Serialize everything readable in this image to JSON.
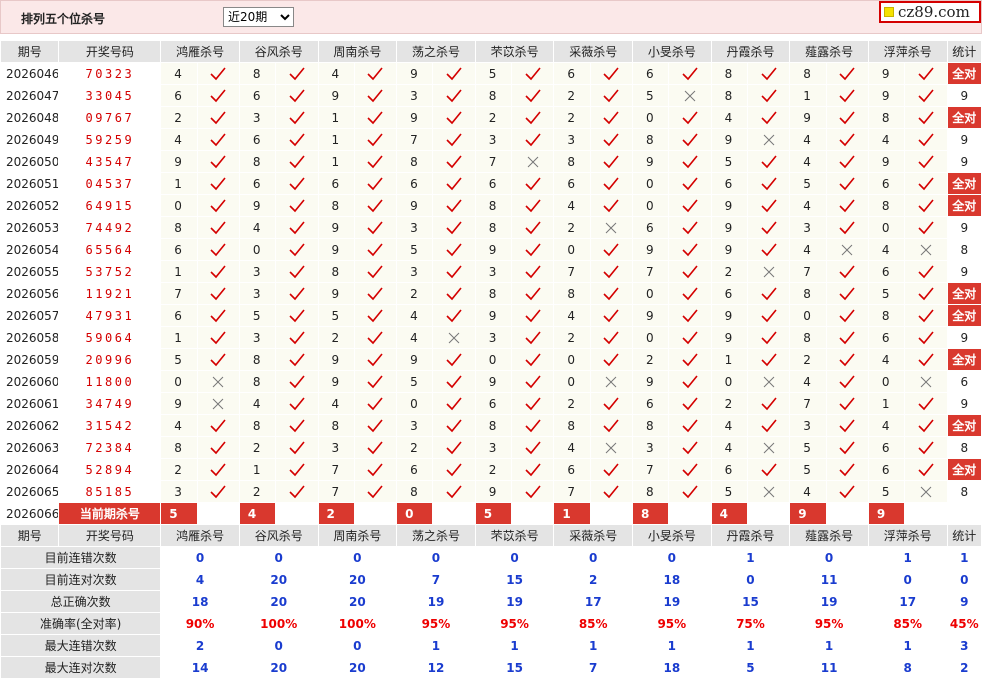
{
  "header": {
    "title": "排列五个位杀号",
    "period_selected": "近20期",
    "logo_text": "cz89.com"
  },
  "columns": {
    "issue": "期号",
    "number": "开奖号码",
    "stat": "统计",
    "killers": [
      "鸿雁杀号",
      "谷风杀号",
      "周南杀号",
      "荡之杀号",
      "芣苡杀号",
      "采薇杀号",
      "小旻杀号",
      "丹霞杀号",
      "薤露杀号",
      "浮萍杀号"
    ]
  },
  "marks": {
    "all_right": "全对"
  },
  "rows": [
    {
      "issue": "2026046",
      "number": "70323",
      "kills": [
        4,
        8,
        4,
        9,
        5,
        6,
        6,
        8,
        8,
        9
      ],
      "hits": [
        1,
        1,
        1,
        1,
        1,
        1,
        1,
        1,
        1,
        1
      ],
      "stat": "全对"
    },
    {
      "issue": "2026047",
      "number": "33045",
      "kills": [
        6,
        6,
        9,
        3,
        8,
        2,
        5,
        8,
        1,
        9
      ],
      "hits": [
        1,
        1,
        1,
        1,
        1,
        1,
        0,
        1,
        1,
        1
      ],
      "stat": "9"
    },
    {
      "issue": "2026048",
      "number": "09767",
      "kills": [
        2,
        3,
        1,
        9,
        2,
        2,
        0,
        4,
        9,
        8
      ],
      "hits": [
        1,
        1,
        1,
        1,
        1,
        1,
        1,
        1,
        1,
        1
      ],
      "stat": "全对"
    },
    {
      "issue": "2026049",
      "number": "59259",
      "kills": [
        4,
        6,
        1,
        7,
        3,
        3,
        8,
        9,
        4,
        4
      ],
      "hits": [
        1,
        1,
        1,
        1,
        1,
        1,
        1,
        0,
        1,
        1
      ],
      "stat": "9"
    },
    {
      "issue": "2026050",
      "number": "43547",
      "kills": [
        9,
        8,
        1,
        8,
        7,
        8,
        9,
        5,
        4,
        9
      ],
      "hits": [
        1,
        1,
        1,
        1,
        0,
        1,
        1,
        1,
        1,
        1
      ],
      "stat": "9"
    },
    {
      "issue": "2026051",
      "number": "04537",
      "kills": [
        1,
        6,
        6,
        6,
        6,
        6,
        0,
        6,
        5,
        6
      ],
      "hits": [
        1,
        1,
        1,
        1,
        1,
        1,
        1,
        1,
        1,
        1
      ],
      "stat": "全对"
    },
    {
      "issue": "2026052",
      "number": "64915",
      "kills": [
        0,
        9,
        8,
        9,
        8,
        4,
        0,
        9,
        4,
        8
      ],
      "hits": [
        1,
        1,
        1,
        1,
        1,
        1,
        1,
        1,
        1,
        1
      ],
      "stat": "全对"
    },
    {
      "issue": "2026053",
      "number": "74492",
      "kills": [
        8,
        4,
        9,
        3,
        8,
        2,
        6,
        9,
        3,
        0
      ],
      "hits": [
        1,
        1,
        1,
        1,
        1,
        0,
        1,
        1,
        1,
        1
      ],
      "stat": "9"
    },
    {
      "issue": "2026054",
      "number": "65564",
      "kills": [
        6,
        0,
        9,
        5,
        9,
        0,
        9,
        9,
        4,
        4
      ],
      "hits": [
        1,
        1,
        1,
        1,
        1,
        1,
        1,
        1,
        0,
        0
      ],
      "stat": "8"
    },
    {
      "issue": "2026055",
      "number": "53752",
      "kills": [
        1,
        3,
        8,
        3,
        3,
        7,
        7,
        2,
        7,
        6
      ],
      "hits": [
        1,
        1,
        1,
        1,
        1,
        1,
        1,
        0,
        1,
        1
      ],
      "stat": "9"
    },
    {
      "issue": "2026056",
      "number": "11921",
      "kills": [
        7,
        3,
        9,
        2,
        8,
        8,
        0,
        6,
        8,
        5
      ],
      "hits": [
        1,
        1,
        1,
        1,
        1,
        1,
        1,
        1,
        1,
        1
      ],
      "stat": "全对"
    },
    {
      "issue": "2026057",
      "number": "47931",
      "kills": [
        6,
        5,
        5,
        4,
        9,
        4,
        9,
        9,
        0,
        8
      ],
      "hits": [
        1,
        1,
        1,
        1,
        1,
        1,
        1,
        1,
        1,
        1
      ],
      "stat": "全对"
    },
    {
      "issue": "2026058",
      "number": "59064",
      "kills": [
        1,
        3,
        2,
        4,
        3,
        2,
        0,
        9,
        8,
        6
      ],
      "hits": [
        1,
        1,
        1,
        0,
        1,
        1,
        1,
        1,
        1,
        1
      ],
      "stat": "9"
    },
    {
      "issue": "2026059",
      "number": "20996",
      "kills": [
        5,
        8,
        9,
        9,
        0,
        0,
        2,
        1,
        2,
        4
      ],
      "hits": [
        1,
        1,
        1,
        1,
        1,
        1,
        1,
        1,
        1,
        1
      ],
      "stat": "全对"
    },
    {
      "issue": "2026060",
      "number": "11800",
      "kills": [
        0,
        8,
        9,
        5,
        9,
        0,
        9,
        0,
        4,
        0
      ],
      "hits": [
        0,
        1,
        1,
        1,
        1,
        0,
        1,
        0,
        1,
        0
      ],
      "stat": "6"
    },
    {
      "issue": "2026061",
      "number": "34749",
      "kills": [
        9,
        4,
        4,
        0,
        6,
        2,
        6,
        2,
        7,
        1
      ],
      "hits": [
        0,
        1,
        1,
        1,
        1,
        1,
        1,
        1,
        1,
        1
      ],
      "stat": "9"
    },
    {
      "issue": "2026062",
      "number": "31542",
      "kills": [
        4,
        8,
        8,
        3,
        8,
        8,
        8,
        4,
        3,
        4
      ],
      "hits": [
        1,
        1,
        1,
        1,
        1,
        1,
        1,
        1,
        1,
        1
      ],
      "stat": "全对"
    },
    {
      "issue": "2026063",
      "number": "72384",
      "kills": [
        8,
        2,
        3,
        2,
        3,
        4,
        3,
        4,
        5,
        6
      ],
      "hits": [
        1,
        1,
        1,
        1,
        1,
        0,
        1,
        0,
        1,
        1
      ],
      "stat": "8"
    },
    {
      "issue": "2026064",
      "number": "52894",
      "kills": [
        2,
        1,
        7,
        6,
        2,
        6,
        7,
        6,
        5,
        6
      ],
      "hits": [
        1,
        1,
        1,
        1,
        1,
        1,
        1,
        1,
        1,
        1
      ],
      "stat": "全对"
    },
    {
      "issue": "2026065",
      "number": "85185",
      "kills": [
        3,
        2,
        7,
        8,
        9,
        7,
        8,
        5,
        4,
        5
      ],
      "hits": [
        1,
        1,
        1,
        1,
        1,
        1,
        1,
        0,
        1,
        0
      ],
      "stat": "8"
    }
  ],
  "current": {
    "issue": "2026066",
    "label": "当前期杀号",
    "kills": [
      5,
      4,
      2,
      0,
      5,
      1,
      8,
      4,
      9,
      9
    ]
  },
  "stats": [
    {
      "label": "目前连错次数",
      "values": [
        "0",
        "0",
        "0",
        "0",
        "0",
        "0",
        "0",
        "1",
        "0",
        "1"
      ],
      "total": "1",
      "red": false
    },
    {
      "label": "目前连对次数",
      "values": [
        "4",
        "20",
        "20",
        "7",
        "15",
        "2",
        "18",
        "0",
        "11",
        "0"
      ],
      "total": "0",
      "red": false
    },
    {
      "label": "总正确次数",
      "values": [
        "18",
        "20",
        "20",
        "19",
        "19",
        "17",
        "19",
        "15",
        "19",
        "17"
      ],
      "total": "9",
      "red": false
    },
    {
      "label": "准确率(全对率)",
      "values": [
        "90%",
        "100%",
        "100%",
        "95%",
        "95%",
        "85%",
        "95%",
        "75%",
        "95%",
        "85%"
      ],
      "total": "45%",
      "red": true
    },
    {
      "label": "最大连错次数",
      "values": [
        "2",
        "0",
        "0",
        "1",
        "1",
        "1",
        "1",
        "1",
        "1",
        "1"
      ],
      "total": "3",
      "red": false
    },
    {
      "label": "最大连对次数",
      "values": [
        "14",
        "20",
        "20",
        "12",
        "15",
        "7",
        "18",
        "5",
        "11",
        "8"
      ],
      "total": "2",
      "red": false
    }
  ],
  "colors": {
    "hit": "#d40000",
    "miss": "#777777",
    "badge": "#d9382e",
    "stat_blue": "#1a3ccf",
    "stat_red": "#e00000"
  },
  "icons": {
    "hit": "check-icon",
    "miss": "cross-icon"
  }
}
